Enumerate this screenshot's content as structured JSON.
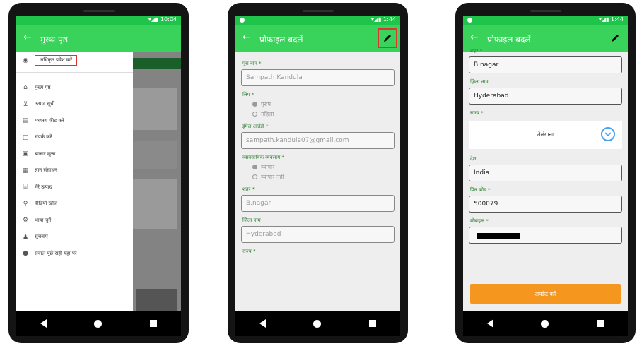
{
  "colors": {
    "status_bar": "#1fc44a",
    "app_bar": "#39d35c",
    "label_green": "#2e7d32",
    "save_button": "#f5961f",
    "chevron": "#4aa3f0"
  },
  "phone1": {
    "status_icons": "▾◢▮ 10:04",
    "app_title": "मुख्य पृष्ठ",
    "drawer": {
      "items": [
        {
          "icon": "account-icon",
          "glyph": "◉",
          "label": "अधिकृत प्रवेश करें"
        },
        {
          "icon": "home-icon",
          "glyph": "⌂",
          "label": "मुख्य पृष्ठ"
        },
        {
          "icon": "cart-icon",
          "glyph": "⊻",
          "label": "उत्पाद सूची"
        },
        {
          "icon": "document-icon",
          "glyph": "▤",
          "label": "मध्यस्थ फीड करें"
        },
        {
          "icon": "chat-icon",
          "glyph": "▢",
          "label": "संपर्क करें"
        },
        {
          "icon": "grid-icon",
          "glyph": "▣",
          "label": "बाजार मूल्य"
        },
        {
          "icon": "calendar-icon",
          "glyph": "▦",
          "label": "ज्ञान संसाधन"
        },
        {
          "icon": "store-icon",
          "glyph": "⌸",
          "label": "मेरे उत्पाद"
        },
        {
          "icon": "search-icon",
          "glyph": "⚲",
          "label": "वीडियो खोज"
        },
        {
          "icon": "settings-icon",
          "glyph": "⚙",
          "label": "भाषा चुनें"
        },
        {
          "icon": "bell-icon",
          "glyph": "♟",
          "label": "सूचनाएं"
        },
        {
          "icon": "info-icon",
          "glyph": "●",
          "label": "सवाल पूछें सही यहां पर"
        }
      ]
    }
  },
  "phone2": {
    "status_icons": "▾◢▮ 1:44",
    "app_title": "प्रोफ़ाइल बदलें",
    "fields": {
      "name": {
        "label": "पूरा नाम *",
        "value": "Sampath Kandula"
      },
      "gender": {
        "label": "लिंग *",
        "options": [
          "पुरुष",
          "महिला"
        ]
      },
      "email": {
        "label": "ईमेल आईडी *",
        "value": "sampath.kandula07@gmail.com"
      },
      "farmer": {
        "label": "व्यावसायिक व्यवसाय *",
        "options": [
          "व्यापार",
          "व्यापार नहीं"
        ]
      },
      "city": {
        "label": "शहर *",
        "value": "B.nagar"
      },
      "district": {
        "label": "ज़िला नाम",
        "value": "Hyderabad"
      },
      "state_label": "राज्य *"
    }
  },
  "phone3": {
    "status_icons": "▾◢▮ 1:44",
    "app_title": "प्रोफ़ाइल बदलें",
    "fields": {
      "city": {
        "label": "शहर *",
        "value": "B nagar"
      },
      "district": {
        "label": "ज़िला नाम",
        "value": "Hyderabad"
      },
      "state": {
        "label": "राज्य *",
        "value": "तेलंगाना"
      },
      "country": {
        "label": "देश",
        "value": "India"
      },
      "pincode": {
        "label": "पिन कोड *",
        "value": "500079"
      },
      "phone": {
        "label": "मोबाइल *"
      }
    },
    "save_label": "अपडेट करें"
  }
}
